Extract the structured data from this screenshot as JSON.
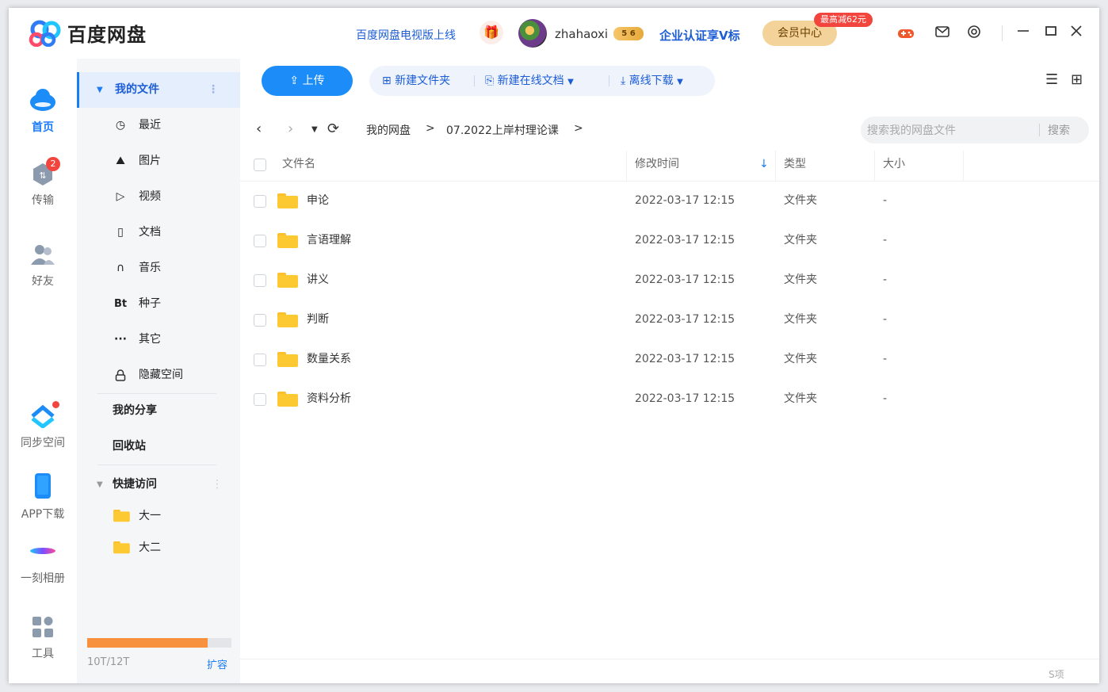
{
  "app": {
    "name": "百度网盘"
  },
  "header": {
    "promo": "百度网盘电视版上线",
    "username": "zhahaoxi",
    "vip_badge": "5 6",
    "enterprise": "企业认证享V标",
    "member_center": "会员中心",
    "member_tag": "最高减62元"
  },
  "nav": {
    "home": "首页",
    "transfer": "传输",
    "transfer_badge": "2",
    "friends": "好友",
    "sync": "同步空间",
    "app_download": "APP下载",
    "moment_album": "一刻相册",
    "tools": "工具"
  },
  "sidebar": {
    "my_files": "我的文件",
    "items": [
      "最近",
      "图片",
      "视频",
      "文档",
      "音乐",
      "种子",
      "其它",
      "隐藏空间"
    ],
    "bt_label": "Bt",
    "my_share": "我的分享",
    "recycle": "回收站",
    "quick_access": "快捷访问",
    "quick_items": [
      "大一",
      "大二"
    ],
    "quota": {
      "text": "10T/12T",
      "used_fraction": 0.833,
      "expand": "扩容"
    }
  },
  "toolbar": {
    "upload": "上传",
    "new_folder": "新建文件夹",
    "new_online_doc": "新建在线文档",
    "offline_download": "离线下载"
  },
  "path": {
    "crumbs": [
      "我的网盘",
      "07.2022上岸村理论课"
    ],
    "search_placeholder": "搜索我的网盘文件",
    "search_button": "搜索"
  },
  "table": {
    "headers": {
      "name": "文件名",
      "modified": "修改时间",
      "type": "类型",
      "size": "大小"
    },
    "rows": [
      {
        "name": "申论",
        "modified": "2022-03-17 12:15",
        "type": "文件夹",
        "size": "-"
      },
      {
        "name": "言语理解",
        "modified": "2022-03-17 12:15",
        "type": "文件夹",
        "size": "-"
      },
      {
        "name": "讲义",
        "modified": "2022-03-17 12:15",
        "type": "文件夹",
        "size": "-"
      },
      {
        "name": "判断",
        "modified": "2022-03-17 12:15",
        "type": "文件夹",
        "size": "-"
      },
      {
        "name": "数量关系",
        "modified": "2022-03-17 12:15",
        "type": "文件夹",
        "size": "-"
      },
      {
        "name": "资料分析",
        "modified": "2022-03-17 12:15",
        "type": "文件夹",
        "size": "-"
      }
    ]
  },
  "footer": {
    "corner": "S项"
  },
  "colors": {
    "accent": "#1c8cf8",
    "folder": "#fcc933",
    "quota": "#f7913d",
    "member": "#f4d39a"
  }
}
